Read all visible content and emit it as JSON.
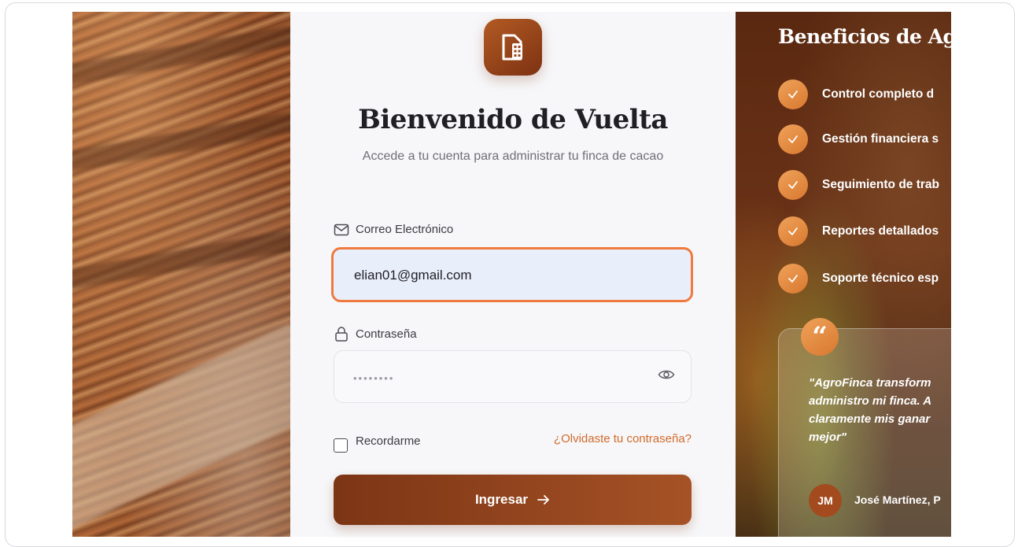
{
  "login": {
    "title": "Bienvenido de Vuelta",
    "subtitle": "Accede a tu cuenta para administrar tu finca de cacao",
    "email_label": "Correo Electrónico",
    "email_value": "elian01@gmail.com",
    "password_label": "Contraseña",
    "password_value": "••••••••",
    "remember_label": "Recordarme",
    "forgot_label": "¿Olvidaste tu contraseña?",
    "submit_label": "Ingresar",
    "submit_icon": "arrow-right-icon"
  },
  "benefits": {
    "title": "Beneficios de Ag",
    "items": [
      "Control completo d",
      "Gestión financiera s",
      "Seguimiento de trab",
      "Reportes detallados",
      "Soporte técnico esp"
    ]
  },
  "testimonial": {
    "quote": "\"AgroFinca transform\nadministro mi finca. A\nclaramente mis ganar\nmejor\"",
    "avatar_initials": "JM",
    "author": "José Martínez, P"
  },
  "colors": {
    "accent": "#f07a3e",
    "brand": "#7c3515",
    "link": "#d06a2a"
  }
}
